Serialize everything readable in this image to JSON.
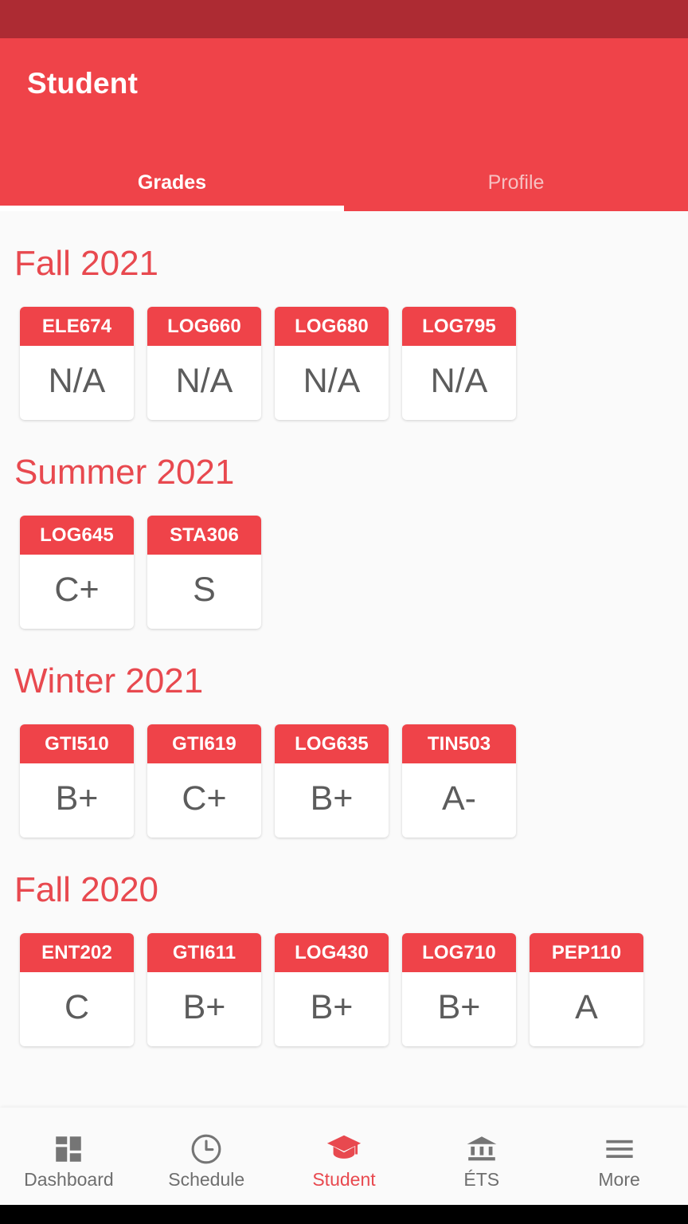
{
  "theme": {
    "status_bar_color": "#ad2b33",
    "app_bar_color": "#ef4349",
    "accent_color": "#e8494f",
    "page_background": "#fafafa",
    "card_header_color": "#ef4349",
    "grade_text_color": "#5c5c5c",
    "nav_inactive_color": "#6e6e6e"
  },
  "app_bar": {
    "title": "Student",
    "tabs": [
      {
        "label": "Grades",
        "active": true
      },
      {
        "label": "Profile",
        "active": false
      }
    ]
  },
  "terms": [
    {
      "title": "Fall 2021",
      "courses": [
        {
          "code": "ELE674",
          "grade": "N/A"
        },
        {
          "code": "LOG660",
          "grade": "N/A"
        },
        {
          "code": "LOG680",
          "grade": "N/A"
        },
        {
          "code": "LOG795",
          "grade": "N/A"
        }
      ]
    },
    {
      "title": "Summer 2021",
      "courses": [
        {
          "code": "LOG645",
          "grade": "C+"
        },
        {
          "code": "STA306",
          "grade": "S"
        }
      ]
    },
    {
      "title": "Winter 2021",
      "courses": [
        {
          "code": "GTI510",
          "grade": "B+"
        },
        {
          "code": "GTI619",
          "grade": "C+"
        },
        {
          "code": "LOG635",
          "grade": "B+"
        },
        {
          "code": "TIN503",
          "grade": "A-"
        }
      ]
    },
    {
      "title": "Fall 2020",
      "courses": [
        {
          "code": "ENT202",
          "grade": "C"
        },
        {
          "code": "GTI611",
          "grade": "B+"
        },
        {
          "code": "LOG430",
          "grade": "B+"
        },
        {
          "code": "LOG710",
          "grade": "B+"
        },
        {
          "code": "PEP110",
          "grade": "A"
        }
      ]
    }
  ],
  "bottom_nav": {
    "items": [
      {
        "label": "Dashboard",
        "icon": "dashboard-grid-icon",
        "active": false
      },
      {
        "label": "Schedule",
        "icon": "clock-icon",
        "active": false
      },
      {
        "label": "Student",
        "icon": "graduation-cap-icon",
        "active": true
      },
      {
        "label": "ÉTS",
        "icon": "bank-columns-icon",
        "active": false
      },
      {
        "label": "More",
        "icon": "hamburger-menu-icon",
        "active": false
      }
    ]
  }
}
